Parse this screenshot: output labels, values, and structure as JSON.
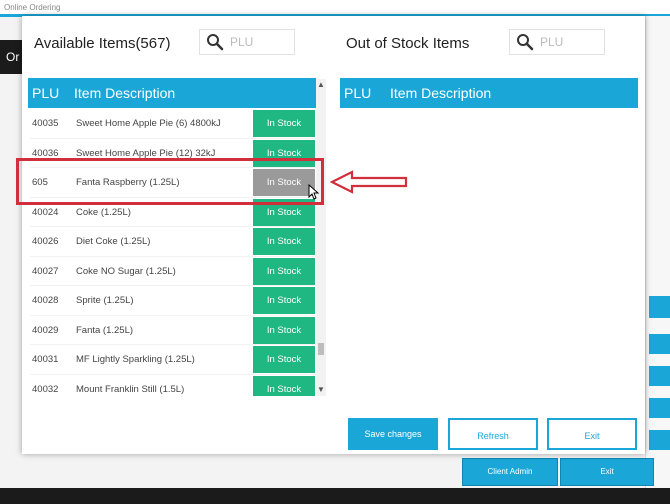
{
  "app": {
    "window_title": "Online Ordering",
    "side_button_label": "Or"
  },
  "background_buttons": {
    "client_admin": "Client Admin",
    "exit": "Exit"
  },
  "available": {
    "heading": "Available Items(567)",
    "search_placeholder": "PLU",
    "columns": {
      "plu": "PLU",
      "description": "Item Description"
    },
    "rows": [
      {
        "plu": "40035",
        "description": "Sweet Home Apple Pie (6) 4800kJ",
        "status": "In Stock"
      },
      {
        "plu": "40036",
        "description": "Sweet Home Apple Pie (12) 32kJ",
        "status": "In Stock"
      },
      {
        "plu": "605",
        "description": "Fanta Raspberry (1.25L)",
        "status": "In Stock"
      },
      {
        "plu": "40024",
        "description": "Coke (1.25L)",
        "status": "In Stock"
      },
      {
        "plu": "40026",
        "description": "Diet Coke (1.25L)",
        "status": "In Stock"
      },
      {
        "plu": "40027",
        "description": "Coke NO Sugar (1.25L)",
        "status": "In Stock"
      },
      {
        "plu": "40028",
        "description": "Sprite (1.25L)",
        "status": "In Stock"
      },
      {
        "plu": "40029",
        "description": "Fanta (1.25L)",
        "status": "In Stock"
      },
      {
        "plu": "40031",
        "description": "MF Lightly Sparkling (1.25L)",
        "status": "In Stock"
      },
      {
        "plu": "40032",
        "description": "Mount Franklin Still (1.5L)",
        "status": "In Stock"
      }
    ]
  },
  "out_of_stock": {
    "heading": "Out of Stock Items",
    "search_placeholder": "PLU",
    "columns": {
      "plu": "PLU",
      "description": "Item Description"
    }
  },
  "actions": {
    "save": "Save changes",
    "refresh": "Refresh",
    "exit": "Exit"
  },
  "colors": {
    "accent": "#1aa7d8",
    "in_stock": "#1fb883",
    "selected": "#9a9a9a",
    "annotation": "#d12f3b"
  }
}
